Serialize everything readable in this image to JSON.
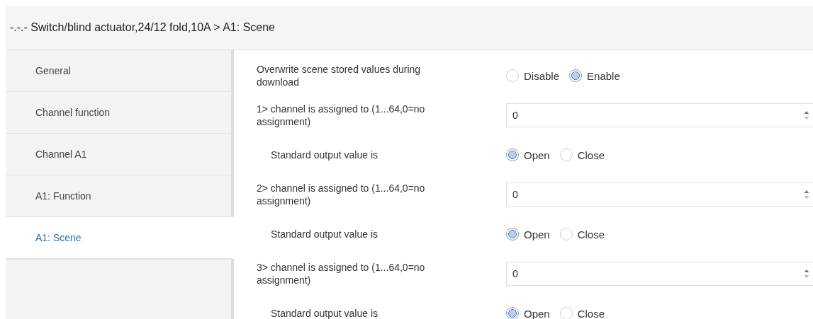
{
  "header": {
    "title": "-.-.- Switch/blind actuator,24/12 fold,10A > A1: Scene"
  },
  "sidebar": {
    "items": [
      {
        "label": "General",
        "selected": false
      },
      {
        "label": "Channel function",
        "selected": false
      },
      {
        "label": "Channel A1",
        "selected": false
      },
      {
        "label": "A1: Function",
        "selected": false
      },
      {
        "label": "A1: Scene",
        "selected": true
      }
    ]
  },
  "parameters": [
    {
      "kind": "radio",
      "label": "Overwrite scene stored values during download",
      "indented": false,
      "options": [
        {
          "label": "Disable",
          "selected": false
        },
        {
          "label": "Enable",
          "selected": true
        }
      ]
    },
    {
      "kind": "number",
      "label": "1> channel is assigned to (1...64,0=no assignment)",
      "indented": false,
      "value": "0"
    },
    {
      "kind": "radio",
      "label": "Standard output value is",
      "indented": true,
      "options": [
        {
          "label": "Open",
          "selected": true
        },
        {
          "label": "Close",
          "selected": false
        }
      ]
    },
    {
      "kind": "number",
      "label": "2> channel is assigned to (1...64,0=no assignment)",
      "indented": false,
      "value": "0"
    },
    {
      "kind": "radio",
      "label": "Standard output value is",
      "indented": true,
      "options": [
        {
          "label": "Open",
          "selected": true
        },
        {
          "label": "Close",
          "selected": false
        }
      ]
    },
    {
      "kind": "number",
      "label": "3> channel is assigned to (1...64,0=no assignment)",
      "indented": false,
      "value": "0"
    },
    {
      "kind": "radio",
      "label": "Standard output value is",
      "indented": true,
      "options": [
        {
          "label": "Open",
          "selected": true
        },
        {
          "label": "Close",
          "selected": false
        }
      ]
    }
  ]
}
